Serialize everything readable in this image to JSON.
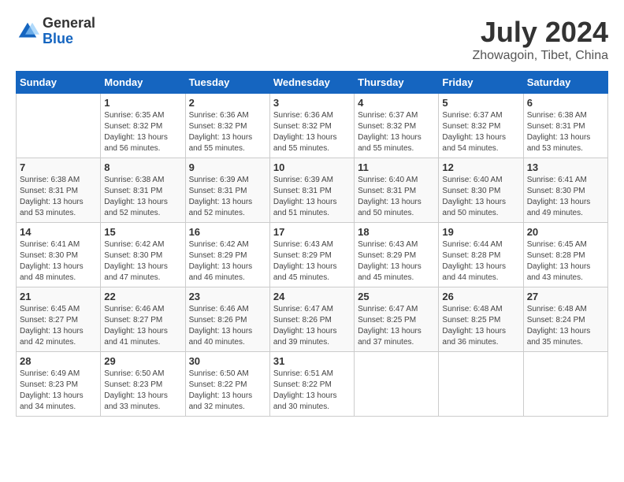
{
  "header": {
    "logo": {
      "general": "General",
      "blue": "Blue"
    },
    "title": "July 2024",
    "location": "Zhowagoin, Tibet, China"
  },
  "days_of_week": [
    "Sunday",
    "Monday",
    "Tuesday",
    "Wednesday",
    "Thursday",
    "Friday",
    "Saturday"
  ],
  "weeks": [
    [
      {
        "day": "",
        "sunrise": "",
        "sunset": "",
        "daylight": ""
      },
      {
        "day": "1",
        "sunrise": "Sunrise: 6:35 AM",
        "sunset": "Sunset: 8:32 PM",
        "daylight": "Daylight: 13 hours and 56 minutes."
      },
      {
        "day": "2",
        "sunrise": "Sunrise: 6:36 AM",
        "sunset": "Sunset: 8:32 PM",
        "daylight": "Daylight: 13 hours and 55 minutes."
      },
      {
        "day": "3",
        "sunrise": "Sunrise: 6:36 AM",
        "sunset": "Sunset: 8:32 PM",
        "daylight": "Daylight: 13 hours and 55 minutes."
      },
      {
        "day": "4",
        "sunrise": "Sunrise: 6:37 AM",
        "sunset": "Sunset: 8:32 PM",
        "daylight": "Daylight: 13 hours and 55 minutes."
      },
      {
        "day": "5",
        "sunrise": "Sunrise: 6:37 AM",
        "sunset": "Sunset: 8:32 PM",
        "daylight": "Daylight: 13 hours and 54 minutes."
      },
      {
        "day": "6",
        "sunrise": "Sunrise: 6:38 AM",
        "sunset": "Sunset: 8:31 PM",
        "daylight": "Daylight: 13 hours and 53 minutes."
      }
    ],
    [
      {
        "day": "7",
        "sunrise": "Sunrise: 6:38 AM",
        "sunset": "Sunset: 8:31 PM",
        "daylight": "Daylight: 13 hours and 53 minutes."
      },
      {
        "day": "8",
        "sunrise": "Sunrise: 6:38 AM",
        "sunset": "Sunset: 8:31 PM",
        "daylight": "Daylight: 13 hours and 52 minutes."
      },
      {
        "day": "9",
        "sunrise": "Sunrise: 6:39 AM",
        "sunset": "Sunset: 8:31 PM",
        "daylight": "Daylight: 13 hours and 52 minutes."
      },
      {
        "day": "10",
        "sunrise": "Sunrise: 6:39 AM",
        "sunset": "Sunset: 8:31 PM",
        "daylight": "Daylight: 13 hours and 51 minutes."
      },
      {
        "day": "11",
        "sunrise": "Sunrise: 6:40 AM",
        "sunset": "Sunset: 8:31 PM",
        "daylight": "Daylight: 13 hours and 50 minutes."
      },
      {
        "day": "12",
        "sunrise": "Sunrise: 6:40 AM",
        "sunset": "Sunset: 8:30 PM",
        "daylight": "Daylight: 13 hours and 50 minutes."
      },
      {
        "day": "13",
        "sunrise": "Sunrise: 6:41 AM",
        "sunset": "Sunset: 8:30 PM",
        "daylight": "Daylight: 13 hours and 49 minutes."
      }
    ],
    [
      {
        "day": "14",
        "sunrise": "Sunrise: 6:41 AM",
        "sunset": "Sunset: 8:30 PM",
        "daylight": "Daylight: 13 hours and 48 minutes."
      },
      {
        "day": "15",
        "sunrise": "Sunrise: 6:42 AM",
        "sunset": "Sunset: 8:30 PM",
        "daylight": "Daylight: 13 hours and 47 minutes."
      },
      {
        "day": "16",
        "sunrise": "Sunrise: 6:42 AM",
        "sunset": "Sunset: 8:29 PM",
        "daylight": "Daylight: 13 hours and 46 minutes."
      },
      {
        "day": "17",
        "sunrise": "Sunrise: 6:43 AM",
        "sunset": "Sunset: 8:29 PM",
        "daylight": "Daylight: 13 hours and 45 minutes."
      },
      {
        "day": "18",
        "sunrise": "Sunrise: 6:43 AM",
        "sunset": "Sunset: 8:29 PM",
        "daylight": "Daylight: 13 hours and 45 minutes."
      },
      {
        "day": "19",
        "sunrise": "Sunrise: 6:44 AM",
        "sunset": "Sunset: 8:28 PM",
        "daylight": "Daylight: 13 hours and 44 minutes."
      },
      {
        "day": "20",
        "sunrise": "Sunrise: 6:45 AM",
        "sunset": "Sunset: 8:28 PM",
        "daylight": "Daylight: 13 hours and 43 minutes."
      }
    ],
    [
      {
        "day": "21",
        "sunrise": "Sunrise: 6:45 AM",
        "sunset": "Sunset: 8:27 PM",
        "daylight": "Daylight: 13 hours and 42 minutes."
      },
      {
        "day": "22",
        "sunrise": "Sunrise: 6:46 AM",
        "sunset": "Sunset: 8:27 PM",
        "daylight": "Daylight: 13 hours and 41 minutes."
      },
      {
        "day": "23",
        "sunrise": "Sunrise: 6:46 AM",
        "sunset": "Sunset: 8:26 PM",
        "daylight": "Daylight: 13 hours and 40 minutes."
      },
      {
        "day": "24",
        "sunrise": "Sunrise: 6:47 AM",
        "sunset": "Sunset: 8:26 PM",
        "daylight": "Daylight: 13 hours and 39 minutes."
      },
      {
        "day": "25",
        "sunrise": "Sunrise: 6:47 AM",
        "sunset": "Sunset: 8:25 PM",
        "daylight": "Daylight: 13 hours and 37 minutes."
      },
      {
        "day": "26",
        "sunrise": "Sunrise: 6:48 AM",
        "sunset": "Sunset: 8:25 PM",
        "daylight": "Daylight: 13 hours and 36 minutes."
      },
      {
        "day": "27",
        "sunrise": "Sunrise: 6:48 AM",
        "sunset": "Sunset: 8:24 PM",
        "daylight": "Daylight: 13 hours and 35 minutes."
      }
    ],
    [
      {
        "day": "28",
        "sunrise": "Sunrise: 6:49 AM",
        "sunset": "Sunset: 8:23 PM",
        "daylight": "Daylight: 13 hours and 34 minutes."
      },
      {
        "day": "29",
        "sunrise": "Sunrise: 6:50 AM",
        "sunset": "Sunset: 8:23 PM",
        "daylight": "Daylight: 13 hours and 33 minutes."
      },
      {
        "day": "30",
        "sunrise": "Sunrise: 6:50 AM",
        "sunset": "Sunset: 8:22 PM",
        "daylight": "Daylight: 13 hours and 32 minutes."
      },
      {
        "day": "31",
        "sunrise": "Sunrise: 6:51 AM",
        "sunset": "Sunset: 8:22 PM",
        "daylight": "Daylight: 13 hours and 30 minutes."
      },
      {
        "day": "",
        "sunrise": "",
        "sunset": "",
        "daylight": ""
      },
      {
        "day": "",
        "sunrise": "",
        "sunset": "",
        "daylight": ""
      },
      {
        "day": "",
        "sunrise": "",
        "sunset": "",
        "daylight": ""
      }
    ]
  ]
}
